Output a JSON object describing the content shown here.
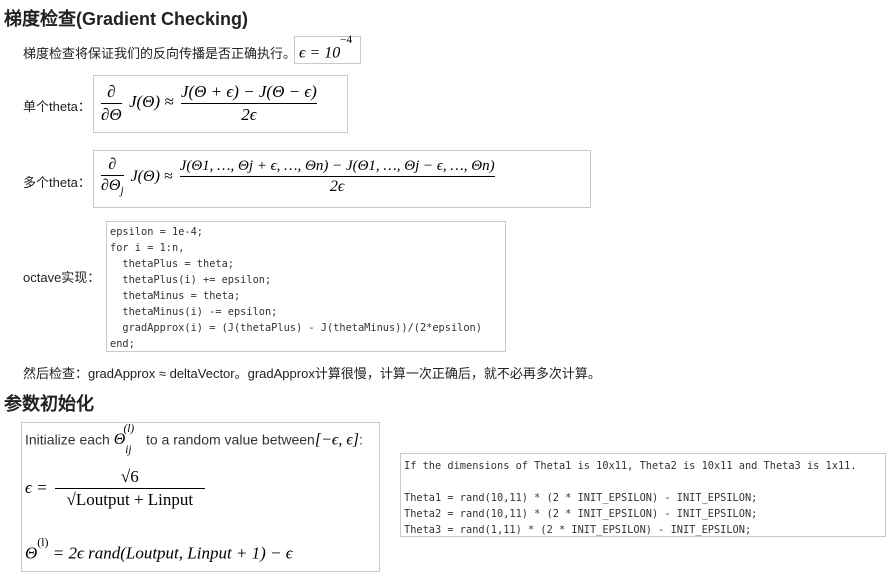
{
  "section1": {
    "heading": "梯度检查(Gradient Checking)",
    "intro": "梯度检查将保证我们的反向传播是否正确执行。",
    "epsilon_lhs": "ϵ = 10",
    "epsilon_exp": "−4",
    "single_label": "单个theta：",
    "single_lhs": "J(Θ) ≈",
    "single_num": "J(Θ + ϵ) − J(Θ − ϵ)",
    "single_den": "2ϵ",
    "multi_label": "多个theta：",
    "multi_num": "J(Θ1, …, Θj + ϵ, …, Θn) − J(Θ1, …, Θj − ϵ, …, Θn)",
    "multi_den": "2ϵ",
    "octave_label": "octave实现：",
    "octave_code": "epsilon = 1e-4;\nfor i = 1:n,\n  thetaPlus = theta;\n  thetaPlus(i) += epsilon;\n  thetaMinus = theta;\n  thetaMinus(i) -= epsilon;\n  gradApprox(i) = (J(thetaPlus) - J(thetaMinus))/(2*epsilon)\nend;",
    "after_check": "然后检查：gradApprox ≈ deltaVector。gradApprox计算很慢，计算一次正确后，就不必再多次计算。"
  },
  "section2": {
    "heading": "参数初始化",
    "init_text": "Initialize each",
    "init_text2": "to a random value between",
    "interval": "[−ϵ, ϵ]",
    "colon": ":",
    "eps_num": "√6",
    "eps_den": "√Loutput + Linput",
    "theta_formula": "= 2ϵ rand(Loutput, Linput + 1) − ϵ",
    "code": "If the dimensions of Theta1 is 10x11, Theta2 is 10x11 and Theta3 is 1x11.\n\nTheta1 = rand(10,11) * (2 * INIT_EPSILON) - INIT_EPSILON;\nTheta2 = rand(10,11) * (2 * INIT_EPSILON) - INIT_EPSILON;\nTheta3 = rand(1,11) * (2 * INIT_EPSILON) - INIT_EPSILON;"
  }
}
